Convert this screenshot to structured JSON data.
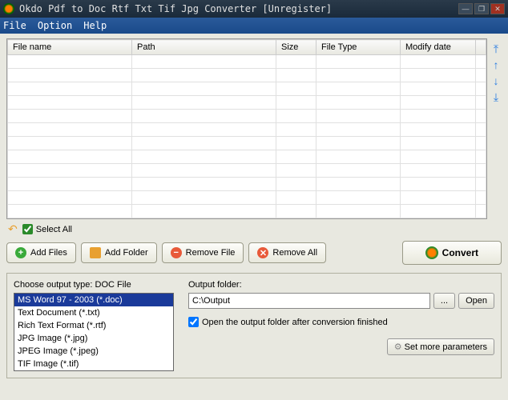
{
  "window": {
    "title": "Okdo Pdf to Doc Rtf Txt Tif Jpg Converter [Unregister]"
  },
  "menu": {
    "file": "File",
    "option": "Option",
    "help": "Help"
  },
  "table": {
    "columns": [
      "File name",
      "Path",
      "Size",
      "File Type",
      "Modify date"
    ]
  },
  "selectAll": "Select All",
  "buttons": {
    "addFiles": "Add Files",
    "addFolder": "Add Folder",
    "removeFile": "Remove File",
    "removeAll": "Remove All",
    "convert": "Convert",
    "browse": "...",
    "open": "Open",
    "setMore": "Set more parameters"
  },
  "outputType": {
    "label": "Choose output type:  DOC File",
    "options": [
      "MS Word 97 - 2003 (*.doc)",
      "Text Document (*.txt)",
      "Rich Text Format (*.rtf)",
      "JPG Image (*.jpg)",
      "JPEG Image (*.jpeg)",
      "TIF Image (*.tif)"
    ]
  },
  "outputFolder": {
    "label": "Output folder:",
    "value": "C:\\Output",
    "openAfter": "Open the output folder after conversion finished"
  }
}
